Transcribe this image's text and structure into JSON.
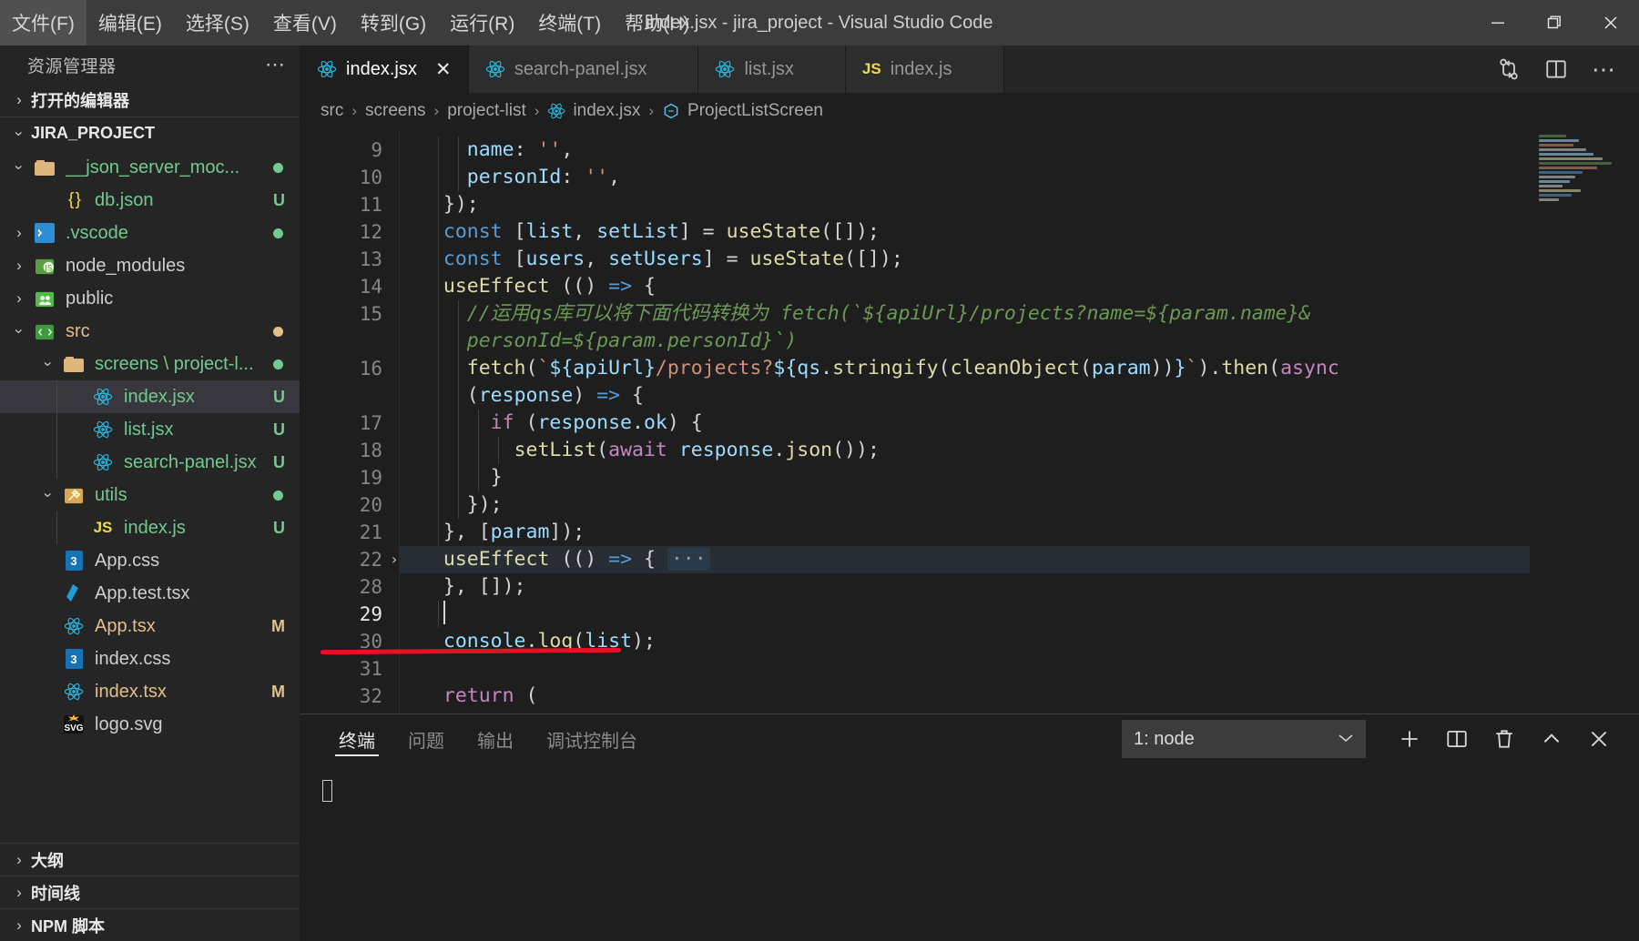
{
  "window": {
    "title": "index.jsx - jira_project - Visual Studio Code",
    "minimize_label": "─",
    "restore_label": "❐",
    "close_label": "✕"
  },
  "menu": [
    {
      "label": "文件(F)",
      "name": "menu-file"
    },
    {
      "label": "编辑(E)",
      "name": "menu-edit"
    },
    {
      "label": "选择(S)",
      "name": "menu-selection"
    },
    {
      "label": "查看(V)",
      "name": "menu-view"
    },
    {
      "label": "转到(G)",
      "name": "menu-go"
    },
    {
      "label": "运行(R)",
      "name": "menu-run"
    },
    {
      "label": "终端(T)",
      "name": "menu-terminal"
    },
    {
      "label": "帮助(H)",
      "name": "menu-help"
    }
  ],
  "sidebar": {
    "title": "资源管理器",
    "more_label": "⋯",
    "open_editors_label": "打开的编辑器",
    "project_label": "JIRA_PROJECT",
    "tree": [
      {
        "label": "__json_server_moc...",
        "icon": "folder-tan-icon",
        "indent": 1,
        "expanded": true,
        "color": "green",
        "status_dot": "#73c991"
      },
      {
        "label": "db.json",
        "icon": "json-icon",
        "indent": 2,
        "color": "green",
        "badge": "U",
        "badge_color": "#73c991"
      },
      {
        "label": ".vscode",
        "icon": "vscode-folder-icon",
        "indent": 1,
        "expanded": false,
        "color": "green",
        "status_dot": "#73c991"
      },
      {
        "label": "node_modules",
        "icon": "node-folder-icon",
        "indent": 1,
        "expanded": false,
        "color": "plain"
      },
      {
        "label": "public",
        "icon": "public-folder-icon",
        "indent": 1,
        "expanded": false,
        "color": "plain"
      },
      {
        "label": "src",
        "icon": "src-folder-icon",
        "indent": 1,
        "expanded": true,
        "color": "orange",
        "status_dot": "#e2c08d"
      },
      {
        "label": "screens \\ project-l...",
        "icon": "folder-tan-icon",
        "indent": 2,
        "expanded": true,
        "color": "green",
        "status_dot": "#73c991"
      },
      {
        "label": "index.jsx",
        "icon": "react-icon",
        "indent": 3,
        "color": "green",
        "badge": "U",
        "badge_color": "#73c991",
        "selected": true
      },
      {
        "label": "list.jsx",
        "icon": "react-icon",
        "indent": 3,
        "color": "green",
        "badge": "U",
        "badge_color": "#73c991"
      },
      {
        "label": "search-panel.jsx",
        "icon": "react-icon",
        "indent": 3,
        "color": "green",
        "badge": "U",
        "badge_color": "#73c991"
      },
      {
        "label": "utils",
        "icon": "utils-folder-icon",
        "indent": 2,
        "expanded": true,
        "color": "green",
        "status_dot": "#73c991"
      },
      {
        "label": "index.js",
        "icon": "js-icon",
        "indent": 3,
        "color": "green",
        "badge": "U",
        "badge_color": "#73c991"
      },
      {
        "label": "App.css",
        "icon": "css-icon",
        "indent": 2,
        "color": "plain"
      },
      {
        "label": "App.test.tsx",
        "icon": "test-icon",
        "indent": 2,
        "color": "plain"
      },
      {
        "label": "App.tsx",
        "icon": "react-icon",
        "indent": 2,
        "color": "orange",
        "badge": "M",
        "badge_color": "#e2c08d"
      },
      {
        "label": "index.css",
        "icon": "css-icon",
        "indent": 2,
        "color": "plain"
      },
      {
        "label": "index.tsx",
        "icon": "react-icon",
        "indent": 2,
        "color": "orange",
        "badge": "M",
        "badge_color": "#e2c08d"
      },
      {
        "label": "logo.svg",
        "icon": "svg-icon",
        "indent": 2,
        "color": "plain"
      }
    ],
    "bottom_sections": [
      {
        "label": "大纲",
        "name": "sidebar-section-outline"
      },
      {
        "label": "时间线",
        "name": "sidebar-section-timeline"
      },
      {
        "label": "NPM 脚本",
        "name": "sidebar-section-npm-scripts"
      }
    ]
  },
  "tabs": [
    {
      "label": "index.jsx",
      "icon": "react-icon",
      "active": true,
      "close_label": "✕"
    },
    {
      "label": "search-panel.jsx",
      "icon": "react-icon",
      "active": false,
      "close_label": "✕"
    },
    {
      "label": "list.jsx",
      "icon": "react-icon",
      "active": false,
      "close_label": "✕"
    },
    {
      "label": "index.js",
      "icon": "js-icon",
      "active": false,
      "close_label": "✕"
    }
  ],
  "editor_actions": [
    {
      "name": "source-control-compare-icon"
    },
    {
      "name": "split-editor-icon"
    },
    {
      "name": "more-actions-icon",
      "label": "⋯"
    }
  ],
  "breadcrumb": [
    {
      "label": "src",
      "icon": null
    },
    {
      "label": "screens",
      "icon": null
    },
    {
      "label": "project-list",
      "icon": null
    },
    {
      "label": "index.jsx",
      "icon": "react-icon"
    },
    {
      "label": "ProjectListScreen",
      "icon": "symbol-function-icon"
    }
  ],
  "breadcrumb_separator": "›",
  "code": {
    "lines": [
      {
        "num": "9",
        "indent": 2
      },
      {
        "num": "10",
        "indent": 2
      },
      {
        "num": "11",
        "indent": 1
      },
      {
        "num": "12",
        "indent": 1
      },
      {
        "num": "13",
        "indent": 1
      },
      {
        "num": "14",
        "indent": 1
      },
      {
        "num": "15",
        "indent": 2,
        "wrapped": true
      },
      {
        "num": "16",
        "indent": 2,
        "wrapped": true
      },
      {
        "num": "17",
        "indent": 3
      },
      {
        "num": "18",
        "indent": 4
      },
      {
        "num": "19",
        "indent": 3
      },
      {
        "num": "20",
        "indent": 2
      },
      {
        "num": "21",
        "indent": 1
      },
      {
        "num": "22",
        "indent": 1,
        "folded": true,
        "highlighted": true
      },
      {
        "num": "28",
        "indent": 1
      },
      {
        "num": "29",
        "indent": 1,
        "current": true
      },
      {
        "num": "30",
        "indent": 1
      },
      {
        "num": "31",
        "indent": 1
      },
      {
        "num": "32",
        "indent": 1
      }
    ],
    "text": {
      "l9": "    name: '',",
      "l10": "    personId: '',",
      "l11": "  });",
      "l12": "  const [list, setList] = useState([]);",
      "l13": "  const [users, setUsers] = useState([]);",
      "l14": "  useEffect (() => {",
      "l15a": "    //运用qs库可以将下面代码转换为 fetch(`${apiUrl}/projects?name=${param.name}&",
      "l15b": "    personId=${param.personId}`)",
      "l16a": "    fetch(`${apiUrl}/projects?${qs.stringify(cleanObject(param))}`).then(async",
      "l16b": "    (response) => {",
      "l17": "      if (response.ok) {",
      "l18": "        setList(await response.json());",
      "l19": "      }",
      "l20": "    });",
      "l21": "  }, [param]);",
      "l22": "  useEffect (() => { ···",
      "l28": "  }, []);",
      "l29": "  ",
      "l30": "  console.log(list);",
      "l31": "",
      "l32": "  return ("
    },
    "folded_indicator": "···",
    "fold_chevron": "›"
  },
  "panel": {
    "tabs": [
      {
        "label": "终端",
        "active": true,
        "name": "panel-tab-terminal"
      },
      {
        "label": "问题",
        "active": false,
        "name": "panel-tab-problems"
      },
      {
        "label": "输出",
        "active": false,
        "name": "panel-tab-output"
      },
      {
        "label": "调试控制台",
        "active": false,
        "name": "panel-tab-debug-console"
      }
    ],
    "terminal_selected": "1: node",
    "select_caret": "⌄",
    "buttons": [
      {
        "name": "new-terminal-button",
        "label": "＋"
      },
      {
        "name": "split-terminal-button",
        "label": ""
      },
      {
        "name": "kill-terminal-button",
        "label": ""
      },
      {
        "name": "maximize-panel-button",
        "label": "⌃"
      },
      {
        "name": "close-panel-button",
        "label": "✕"
      }
    ]
  },
  "colors": {
    "accent_blue": "#007acc",
    "titlebar_bg": "#3c3c3c",
    "sidebar_bg": "#252526",
    "editor_bg": "#1e1e1e",
    "git_untracked": "#73c991",
    "git_modified": "#e2c08d",
    "error_red": "#e81123",
    "selection_bg": "#37373d"
  }
}
